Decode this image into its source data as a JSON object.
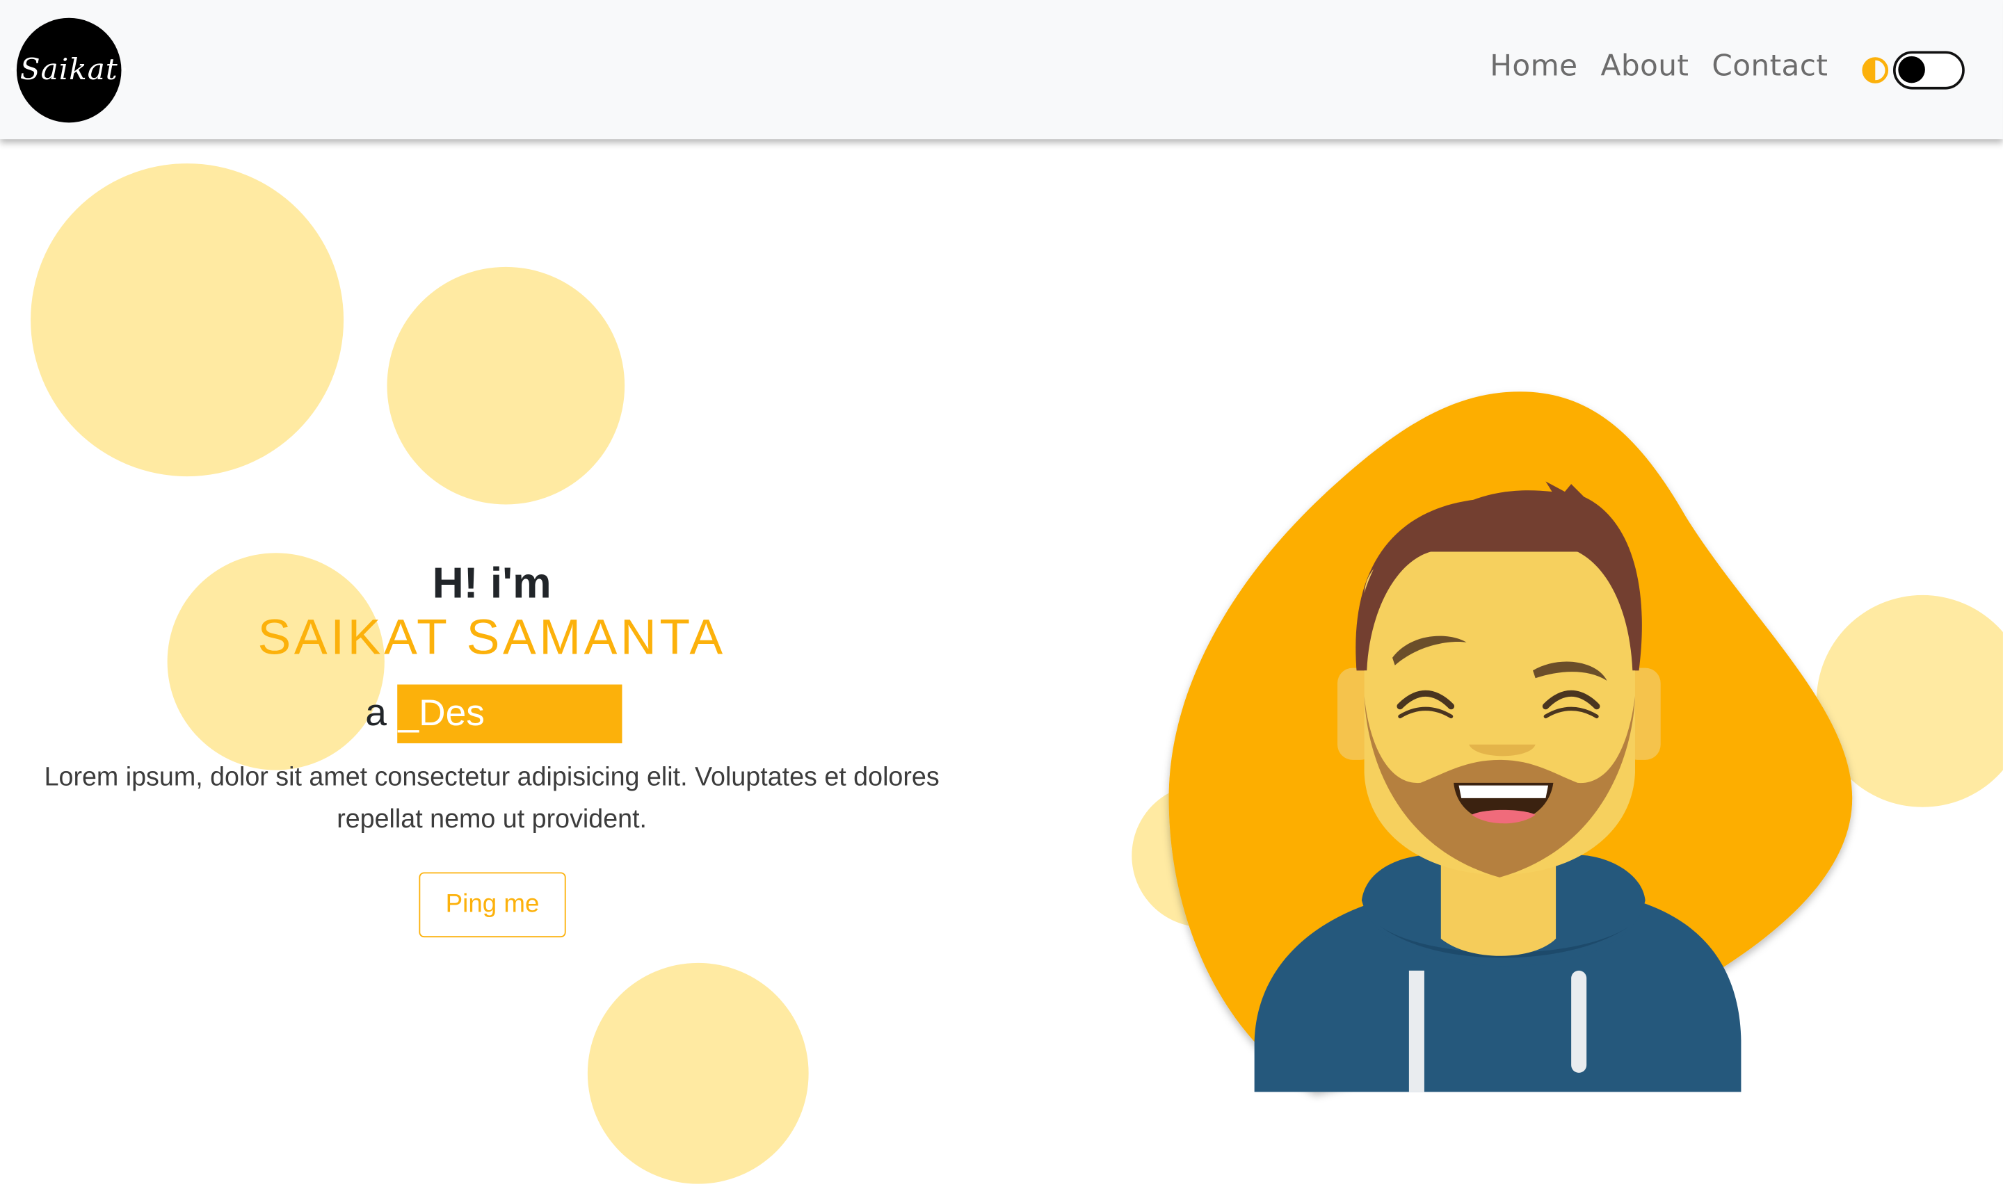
{
  "navbar": {
    "logo_text": "Saikat",
    "links": [
      {
        "label": "Home"
      },
      {
        "label": "About"
      },
      {
        "label": "Contact"
      }
    ],
    "theme_toggle": {
      "state": "off",
      "icon": "contrast-icon"
    }
  },
  "hero": {
    "greeting": "H! i'm",
    "name": "SAIKAT SAMANTA",
    "role_prefix": "a",
    "role_typed": "_Des",
    "description": "Lorem ipsum, dolor sit amet consectetur adipisicing elit. Voluptates et dolores repellat nemo ut provident.",
    "cta_label": "Ping me"
  },
  "illustration": {
    "icon": "smiling-man-avatar"
  },
  "colors": {
    "accent": "#fcb10b",
    "bubble": "#ffeaa2",
    "navbar_bg": "#f8f9fa",
    "text_dark": "#212529",
    "hoodie": "#25587c"
  }
}
